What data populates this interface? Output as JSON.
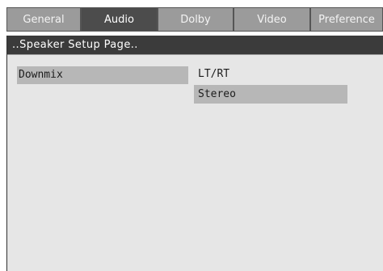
{
  "tabs": [
    {
      "label": "General",
      "active": false
    },
    {
      "label": "Audio",
      "active": true
    },
    {
      "label": "Dolby",
      "active": false
    },
    {
      "label": "Video",
      "active": false
    },
    {
      "label": "Preference",
      "active": false
    }
  ],
  "page": {
    "title": "..Speaker Setup Page.."
  },
  "settings": [
    {
      "label": "Downmix",
      "options": [
        {
          "label": "LT/RT",
          "selected": false
        },
        {
          "label": "Stereo",
          "selected": true
        }
      ]
    }
  ],
  "colors": {
    "tab_inactive": "#9b9b9b",
    "tab_active": "#4c4c4c",
    "page_bar": "#3b3b3b",
    "panel_background": "#e6e6e6",
    "highlight": "#b7b7b7"
  }
}
